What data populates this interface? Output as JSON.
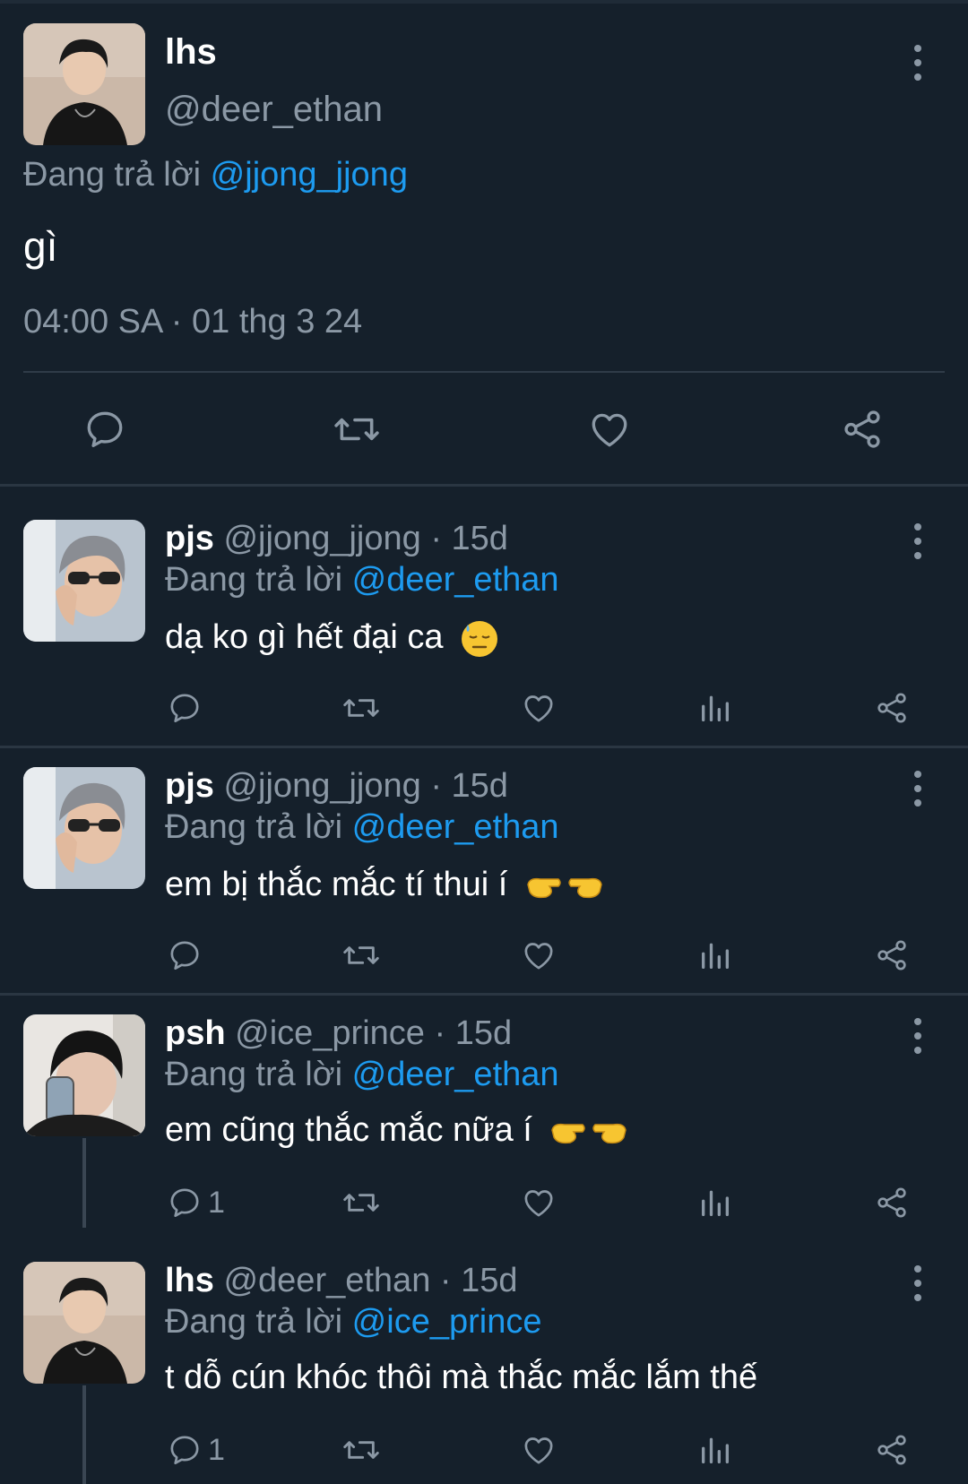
{
  "main_tweet": {
    "name": "lhs",
    "handle": "@deer_ethan",
    "replying_prefix": "Đang trả lời",
    "replying_to": "@jjong_jjong",
    "text": "gì",
    "timestamp": "04:00 SA · 01 thg 3 24"
  },
  "replies": [
    {
      "name": "pjs",
      "handle": "@jjong_jjong",
      "time": "· 15d",
      "replying_prefix": "Đang trả lời",
      "replying_to": "@deer_ethan",
      "text": "dạ ko gì hết đại ca",
      "emoji": "downcast-sweat-face",
      "reply_count": ""
    },
    {
      "name": "pjs",
      "handle": "@jjong_jjong",
      "time": "· 15d",
      "replying_prefix": "Đang trả lời",
      "replying_to": "@deer_ethan",
      "text": "em bị thắc mắc tí thui í",
      "emoji": "pointing-fingers",
      "reply_count": ""
    },
    {
      "name": "psh",
      "handle": "@ice_prince",
      "time": "· 15d",
      "replying_prefix": "Đang trả lời",
      "replying_to": "@deer_ethan",
      "text": "em cũng thắc mắc nữa í",
      "emoji": "pointing-fingers",
      "reply_count": "1"
    },
    {
      "name": "lhs",
      "handle": "@deer_ethan",
      "time": "· 15d",
      "replying_prefix": "Đang trả lời",
      "replying_to": "@ice_prince",
      "text": "t dỗ cún khóc thôi mà thắc mắc lắm thế",
      "emoji": "",
      "reply_count": "1"
    }
  ],
  "icons": {
    "reply": "reply-icon",
    "retweet": "retweet-icon",
    "like": "like-icon",
    "views": "views-icon",
    "share": "share-icon",
    "more": "more-icon"
  },
  "colors": {
    "background": "#15202b",
    "link": "#1d9bf0",
    "muted": "#8b98a5"
  }
}
